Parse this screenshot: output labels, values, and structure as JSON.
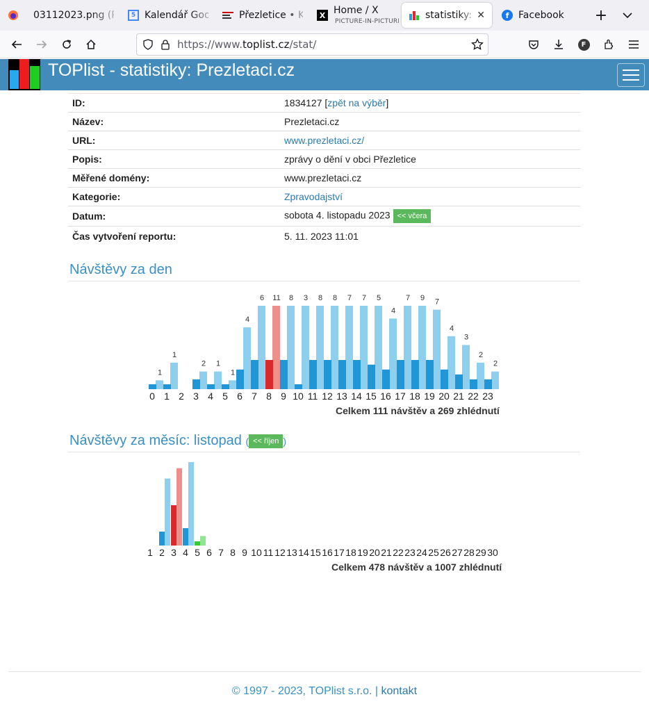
{
  "browser": {
    "tabs": [
      {
        "title": "03112023.png (P",
        "icon": "firefox-icon"
      },
      {
        "title": "Kalendář Goo",
        "icon": "calendar-icon"
      },
      {
        "title": "Přezletice • Ko",
        "icon": "site-icon"
      },
      {
        "title": "Home / X",
        "subtitle": "PICTURE-IN-PICTURE",
        "icon": "x-icon"
      },
      {
        "title": "statistiky: P",
        "icon": "toplist-icon"
      },
      {
        "title": "Facebook",
        "icon": "facebook-icon"
      }
    ],
    "url_prefix": "https://www.",
    "url_domain": "toplist.cz",
    "url_path": "/stat/",
    "new_tab": "+",
    "list_all": "⌄"
  },
  "header": {
    "title": "TOPlist - statistiky: Prezletaci.cz",
    "colors": {
      "bar": "#428bbb",
      "accent": "#5cb85c"
    }
  },
  "info": {
    "rows": [
      {
        "key": "ID:",
        "value": "1834127 [",
        "link": "zpět na výběr",
        "after": "]"
      },
      {
        "key": "Název:",
        "value": "Prezletaci.cz"
      },
      {
        "key": "URL:",
        "link": "www.prezletaci.cz/"
      },
      {
        "key": "Popis:",
        "value": "zprávy o dění v obci Přezletice"
      },
      {
        "key": "Měřené domény:",
        "value": "www.prezletaci.cz"
      },
      {
        "key": "Kategorie:",
        "link": "Zpravodajství"
      },
      {
        "key": "Datum:",
        "value": "sobota 4. listopadu 2023",
        "button": "<< včera"
      },
      {
        "key": "Čas vytvoření reportu:",
        "value": "5. 11. 2023 11:01"
      }
    ]
  },
  "day_section": {
    "title": "Návštěvy za den",
    "total": "Celkem 111 návštěv a 269 zhlédnutí"
  },
  "month_section": {
    "title": "Návštěvy za měsíc: listopad",
    "paren_open": "(",
    "button": "<< říjen",
    "paren_close": ")",
    "total": "Celkem 478 návštěv a 1007 zhlédnutí"
  },
  "chart_data": [
    {
      "type": "bar",
      "title": "Návštěvy za den",
      "categories": [
        "0",
        "1",
        "2",
        "3",
        "4",
        "5",
        "6",
        "7",
        "8",
        "9",
        "10",
        "11",
        "12",
        "13",
        "14",
        "15",
        "16",
        "17",
        "18",
        "19",
        "20",
        "21",
        "22",
        "23"
      ],
      "labels": [
        "",
        "1",
        "1",
        "",
        "2",
        "1",
        "1",
        "4",
        "6",
        "11",
        "8",
        "3",
        "8",
        "8",
        "7",
        "7",
        "5",
        "4",
        "7",
        "9",
        "7",
        "4",
        "3",
        "2",
        "2"
      ],
      "top_labels": [
        "1",
        "1",
        "",
        "2",
        "1",
        "1",
        "4",
        "6",
        "11",
        "8",
        "3",
        "8",
        "8",
        "7",
        "7",
        "5",
        "4",
        "7",
        "9",
        "7",
        "4",
        "3",
        "2",
        "2"
      ],
      "series": [
        {
          "name": "návštěvy",
          "values": [
            1,
            1,
            0,
            2,
            1,
            1,
            4,
            6,
            11,
            8,
            1,
            8,
            8,
            7,
            7,
            5,
            4,
            7,
            9,
            7,
            4,
            3,
            2,
            2
          ]
        },
        {
          "name": "zhlédnutí",
          "values": [
            1,
            3,
            0,
            2,
            2,
            1,
            7,
            13,
            18,
            33,
            29,
            27,
            31,
            27,
            12,
            14,
            8,
            15,
            13,
            9,
            6,
            5,
            3,
            2
          ]
        }
      ],
      "highlight_index": 8,
      "colors": {
        "visits": "#2196d6",
        "views": "#8ecfee",
        "visits_hl": "#d9292b",
        "views_hl": "#ef8f8c"
      },
      "ylim": [
        0,
        34
      ]
    },
    {
      "type": "bar",
      "title": "Návštěvy za měsíc: listopad",
      "categories": [
        "1",
        "2",
        "3",
        "4",
        "5",
        "6",
        "7",
        "8",
        "9",
        "10",
        "11",
        "12",
        "13",
        "14",
        "15",
        "16",
        "17",
        "18",
        "19",
        "20",
        "21",
        "22",
        "23",
        "24",
        "25",
        "26",
        "27",
        "28",
        "29",
        "30"
      ],
      "series": [
        {
          "name": "návštěvy",
          "values": [
            0,
            109,
            111,
            111,
            16,
            0,
            0,
            0,
            0,
            0,
            0,
            0,
            0,
            0,
            0,
            0,
            0,
            0,
            0,
            0,
            0,
            0,
            0,
            0,
            0,
            0,
            0,
            0,
            0,
            0
          ]
        },
        {
          "name": "zhlédnutí",
          "values": [
            0,
            233,
            269,
            290,
            33,
            0,
            0,
            0,
            0,
            0,
            0,
            0,
            0,
            0,
            0,
            0,
            0,
            0,
            0,
            0,
            0,
            0,
            0,
            0,
            0,
            0,
            0,
            0,
            0,
            0
          ]
        }
      ],
      "highlight_index": 2,
      "current_index": 4,
      "colors": {
        "visits": "#2196d6",
        "views": "#8ecfee",
        "visits_hl": "#d9292b",
        "views_hl": "#ef8f8c",
        "visits_cur": "#36c936",
        "views_cur": "#90e590"
      },
      "ylim": [
        0,
        290
      ]
    }
  ],
  "footer": {
    "copyright": "© 1997 - 2023, TOPlist s.r.o. |",
    "contact": "kontakt"
  }
}
